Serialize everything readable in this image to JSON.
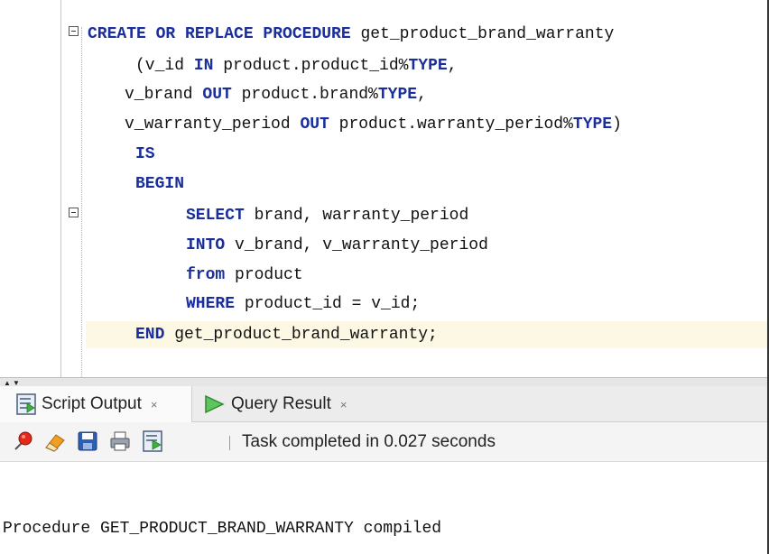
{
  "editor": {
    "lines": [
      [
        {
          "t": "CREATE OR REPLACE PROCEDURE",
          "k": 1
        },
        {
          "t": " get_product_brand_warranty",
          "k": 0
        }
      ],
      [
        {
          "t": "(v_id ",
          "k": 0
        },
        {
          "t": "IN",
          "k": 1
        },
        {
          "t": " product.product_id%",
          "k": 0
        },
        {
          "t": "TYPE",
          "k": 1
        },
        {
          "t": ",",
          "k": 0
        }
      ],
      [
        {
          "t": "v_brand ",
          "k": 0
        },
        {
          "t": "OUT",
          "k": 1
        },
        {
          "t": " product.brand%",
          "k": 0
        },
        {
          "t": "TYPE",
          "k": 1
        },
        {
          "t": ",",
          "k": 0
        }
      ],
      [
        {
          "t": "v_warranty_period ",
          "k": 0
        },
        {
          "t": "OUT",
          "k": 1
        },
        {
          "t": " product.warranty_period%",
          "k": 0
        },
        {
          "t": "TYPE",
          "k": 1
        },
        {
          "t": ")",
          "k": 0
        }
      ],
      [
        {
          "t": "IS",
          "k": 1
        }
      ],
      [
        {
          "t": "BEGIN",
          "k": 1
        }
      ],
      [
        {
          "t": "SELECT",
          "k": 1
        },
        {
          "t": " brand, warranty_period",
          "k": 0
        }
      ],
      [
        {
          "t": "INTO",
          "k": 1
        },
        {
          "t": " v_brand, v_warranty_period",
          "k": 0
        }
      ],
      [
        {
          "t": "from",
          "k": 1
        },
        {
          "t": " product",
          "k": 0
        }
      ],
      [
        {
          "t": "WHERE",
          "k": 1
        },
        {
          "t": " product_id = v_id;",
          "k": 0
        }
      ],
      [
        {
          "t": "END",
          "k": 1
        },
        {
          "t": " get_product_brand_warranty;",
          "k": 0
        }
      ]
    ]
  },
  "tabs": [
    {
      "label": "Script Output",
      "close": "×",
      "icon": "script-output-icon"
    },
    {
      "label": "Query Result",
      "close": "×",
      "icon": "query-result-icon"
    }
  ],
  "toolbar": {
    "icons": [
      "pin-icon",
      "eraser-icon",
      "save-icon",
      "print-icon",
      "script-icon"
    ],
    "status": "Task completed in 0.027 seconds"
  },
  "output": {
    "message": "Procedure GET_PRODUCT_BRAND_WARRANTY compiled"
  },
  "colors": {
    "keyword": "#1a2f9c",
    "current_line": "#fdf8e4",
    "run_arrow": "#3db03d"
  }
}
